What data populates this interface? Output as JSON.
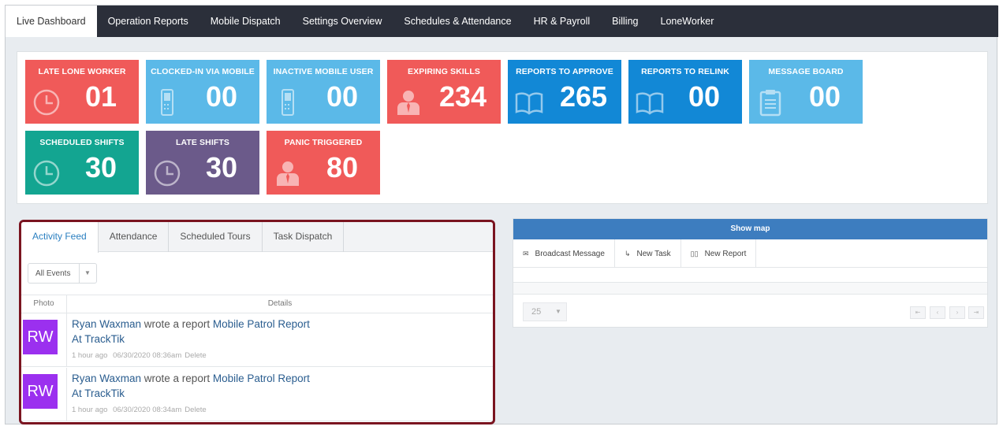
{
  "nav": {
    "tabs": [
      "Live Dashboard",
      "Operation Reports",
      "Mobile Dispatch",
      "Settings Overview",
      "Schedules & Attendance",
      "HR & Payroll",
      "Billing",
      "LoneWorker"
    ],
    "active": "Live Dashboard"
  },
  "tiles": [
    {
      "label": "LATE LONE WORKER",
      "value": "01",
      "icon": "clock-icon",
      "color": "#f05a59"
    },
    {
      "label": "CLOCKED-IN VIA MOBILE",
      "value": "00",
      "icon": "mobile-icon",
      "color": "#5bb9e8"
    },
    {
      "label": "INACTIVE MOBILE USER",
      "value": "00",
      "icon": "mobile-icon",
      "color": "#5bb9e8"
    },
    {
      "label": "EXPIRING SKILLS",
      "value": "234",
      "icon": "person-icon",
      "color": "#f05a59"
    },
    {
      "label": "REPORTS TO APPROVE",
      "value": "265",
      "icon": "book-icon",
      "color": "#1288d6"
    },
    {
      "label": "REPORTS TO RELINK",
      "value": "00",
      "icon": "book-icon",
      "color": "#1288d6"
    },
    {
      "label": "MESSAGE BOARD",
      "value": "00",
      "icon": "clipboard-icon",
      "color": "#5bb9e8"
    },
    {
      "label": "SCHEDULED SHIFTS",
      "value": "30",
      "icon": "clock-icon",
      "color": "#13a591"
    },
    {
      "label": "LATE SHIFTS",
      "value": "30",
      "icon": "clock-icon",
      "color": "#6b5a8a"
    },
    {
      "label": "PANIC TRIGGERED",
      "value": "80",
      "icon": "person-icon",
      "color": "#f05a59"
    }
  ],
  "activity": {
    "tabs": [
      "Activity Feed",
      "Attendance",
      "Scheduled Tours",
      "Task Dispatch"
    ],
    "active_tab": "Activity Feed",
    "filter": "All Events",
    "columns": {
      "photo": "Photo",
      "details": "Details"
    },
    "rows": [
      {
        "initials": "RW",
        "user": "Ryan Waxman",
        "action": " wrote a report ",
        "report": "Mobile Patrol Report",
        "at": "At ",
        "site": "TrackTik",
        "ago": "1 hour ago",
        "time": "06/30/2020 08:36am",
        "delete": "Delete"
      },
      {
        "initials": "RW",
        "user": "Ryan Waxman",
        "action": " wrote a report ",
        "report": "Mobile Patrol Report",
        "at": "At ",
        "site": "TrackTik",
        "ago": "1 hour ago",
        "time": "06/30/2020 08:34am",
        "delete": "Delete"
      }
    ]
  },
  "map_panel": {
    "show_map": "Show map",
    "actions": [
      "Broadcast Message",
      "New Task",
      "New Report"
    ],
    "page_size": "25"
  },
  "colors": {
    "accent": "#7a1420",
    "avatar": "#9b30ef",
    "nav_bg": "#2b2f3a"
  }
}
